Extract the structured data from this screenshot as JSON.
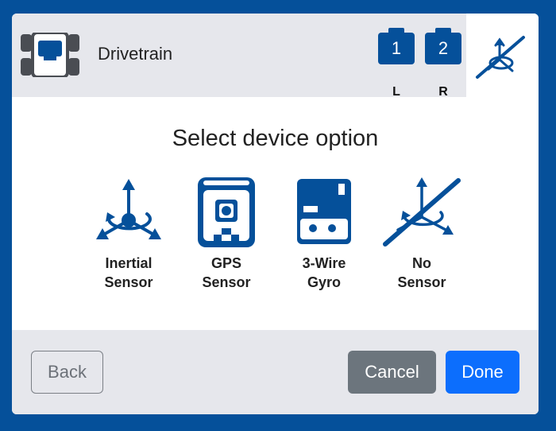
{
  "header": {
    "title": "Drivetrain",
    "ports": [
      {
        "number": "1",
        "side": "L"
      },
      {
        "number": "2",
        "side": "R"
      }
    ],
    "selected_sensor_icon": "no-sensor-icon"
  },
  "main": {
    "heading": "Select device option",
    "options": [
      {
        "line1": "Inertial",
        "line2": "Sensor",
        "icon": "inertial-sensor-icon"
      },
      {
        "line1": "GPS",
        "line2": "Sensor",
        "icon": "gps-sensor-icon"
      },
      {
        "line1": "3-Wire",
        "line2": "Gyro",
        "icon": "gyro-icon"
      },
      {
        "line1": "No",
        "line2": "Sensor",
        "icon": "no-sensor-icon"
      }
    ]
  },
  "footer": {
    "back_label": "Back",
    "cancel_label": "Cancel",
    "done_label": "Done"
  },
  "colors": {
    "brand": "#05509a",
    "cancel": "#6c757d",
    "done": "#0c6efd",
    "panel": "#e6e7ec"
  }
}
